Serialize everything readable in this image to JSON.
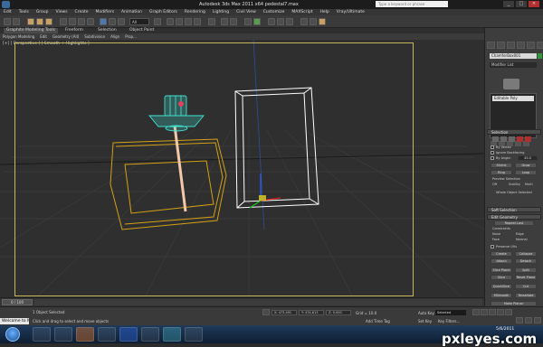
{
  "titlebar": {
    "title": "Autodesk 3ds Max 2011 x64     pedestal7.max",
    "search_placeholder": "Type a keyword or phrase",
    "min": "_",
    "max": "□",
    "close": "×"
  },
  "menu": [
    "Edit",
    "Tools",
    "Group",
    "Views",
    "Create",
    "Modifiers",
    "Animation",
    "Graph Editors",
    "Rendering",
    "Lighting",
    "Civil View",
    "Customize",
    "MAXScript",
    "Help",
    "Vray/Ultimate"
  ],
  "toolbar": {
    "selection_filter": "All"
  },
  "ribbon": {
    "tabs": [
      "Graphite Modeling Tools",
      "Freeform",
      "Selection",
      "Object Paint"
    ],
    "subtabs": [
      "Polygon Modeling",
      "Edit",
      "Geometry (All)",
      "Subdivision",
      "Align",
      "Prop..."
    ]
  },
  "viewport": {
    "label": "[+] [ Perspective ] [ Smooth + Highlights ]"
  },
  "panel": {
    "object_name": "ChamferBox001",
    "modifier_list": "Modifier List",
    "stack_item": "Editable Poly",
    "selection_header": "Selection",
    "by_vertex": "By Vertex",
    "ignore_backfacing": "Ignore Backfacing",
    "by_angle": "By Angle:",
    "angle_value": "45.0",
    "shrink": "Shrink",
    "grow": "Grow",
    "ring": "Ring",
    "loop": "Loop",
    "preview_selection": "Preview Selection",
    "off": "Off",
    "subobj": "SubObj",
    "multi": "Multi",
    "whole_object": "Whole Object Selected",
    "soft_selection": "Soft Selection",
    "edit_geometry": "Edit Geometry",
    "repeat_last": "Repeat Last",
    "constraints": "Constraints",
    "none": "None",
    "edge": "Edge",
    "face": "Face",
    "normal": "Normal",
    "preserve_uvs": "Preserve UVs",
    "create": "Create",
    "collapse": "Collapse",
    "attach": "Attach",
    "detach": "Detach",
    "slice_plane": "Slice Plane",
    "split": "Split",
    "slice": "Slice",
    "reset_plane": "Reset Plane",
    "quickslice": "QuickSlice",
    "cut": "Cut",
    "msmooth": "MSmooth",
    "tessellate": "Tessellate",
    "make_planar": "Make Planar",
    "x": "X",
    "y": "Y",
    "z": "Z"
  },
  "timeline": {
    "frame": "0 / 100"
  },
  "status": {
    "maxscript": "Welcome to MAXScript.",
    "selected": "1 Object Selected",
    "hint": "Click and drag to select and move objects",
    "x": "X: 473.491",
    "y": "Y: 474.613",
    "z": "Z: 0.000",
    "grid": "Grid = 10.0",
    "add_time_tag": "Add Time Tag",
    "auto_key": "Auto Key",
    "set_key": "Set Key",
    "selected_box": "Selected",
    "key_filters": "Key Filters..."
  },
  "taskbar": {
    "time": "5/6/2011"
  },
  "watermark": "pxleyes.com",
  "colors": {
    "viewport_border": "#c9b65a",
    "selection_wire": "#ffffff",
    "object_gold": "#d4a017",
    "object_cyan": "#40e0d0"
  }
}
